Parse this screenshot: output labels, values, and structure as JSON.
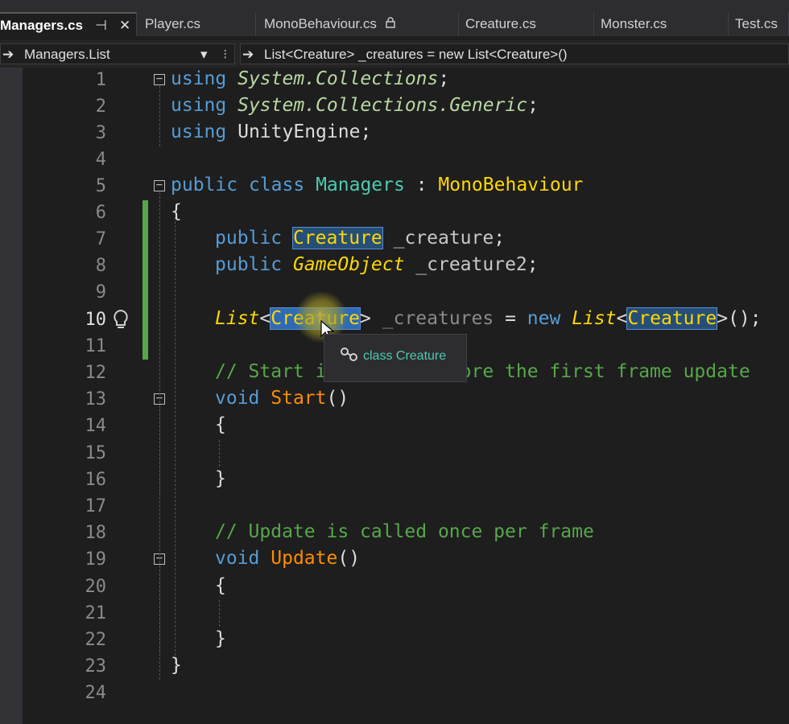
{
  "tabs": [
    {
      "label": "Managers.cs",
      "active": true
    },
    {
      "label": "Player.cs"
    },
    {
      "label": "MonoBehaviour.cs"
    },
    {
      "label": "Creature.cs"
    },
    {
      "label": "Monster.cs"
    },
    {
      "label": "Test.cs"
    }
  ],
  "tab_pin_glyph": "⊣",
  "tab_close_glyph": "✕",
  "lock_icon": "lock-icon",
  "nav": {
    "left": "Managers.List",
    "right": "List<Creature> _creatures = new List<Creature>()",
    "arrow": "➔",
    "dropdown": "▾"
  },
  "gutter": {
    "indicator": "◘↑"
  },
  "line_numbers": [
    "1",
    "2",
    "3",
    "4",
    "5",
    "6",
    "7",
    "8",
    "9",
    "10",
    "11",
    "12",
    "13",
    "14",
    "15",
    "16",
    "17",
    "18",
    "19",
    "20",
    "21",
    "22",
    "23",
    "24"
  ],
  "current_line": "10",
  "code": {
    "l1_kw": "using",
    "l1_ns": "System.Collections",
    "l1_end": ";",
    "l2_kw": "using",
    "l2_ns": "System.Collections.Generic",
    "l2_end": ";",
    "l3_kw": "using",
    "l3_ns": "UnityEngine",
    "l3_end": ";",
    "l5_public": "public",
    "l5_class": "class",
    "l5_name": "Managers",
    "l5_colon": " : ",
    "l5_base": "MonoBehaviour",
    "l6": "{",
    "l7_public": "public",
    "l7_type": "Creature",
    "l7_field": "_creature",
    "l7_end": ";",
    "l8_public": "public",
    "l8_type": "GameObject",
    "l8_field": "_creature2",
    "l8_end": ";",
    "l10_list": "List",
    "l10_lt": "<",
    "l10_type": "Creature",
    "l10_gt": ">",
    "l10_field": "_creatures",
    "l10_eq": " = ",
    "l10_new": "new",
    "l10_list2": "List",
    "l10_lt2": "<",
    "l10_type2": "Creature",
    "l10_gt2": ">",
    "l10_end": "();",
    "l12": "// Start is called before the first frame update",
    "l13_void": "void",
    "l13_name": "Start",
    "l13_end": "()",
    "l14": "{",
    "l16": "}",
    "l18": "// Update is called once per frame",
    "l19_void": "void",
    "l19_name": "Update",
    "l19_end": "()",
    "l20": "{",
    "l22": "}",
    "l23": "}"
  },
  "tooltip": {
    "text": "class Creature",
    "icon": "class-icon"
  },
  "colors": {
    "keyword": "#569cd6",
    "type": "#4ec9b0",
    "comment": "#57a64a",
    "method": "#ff8c00",
    "interface": "#ffd700"
  }
}
